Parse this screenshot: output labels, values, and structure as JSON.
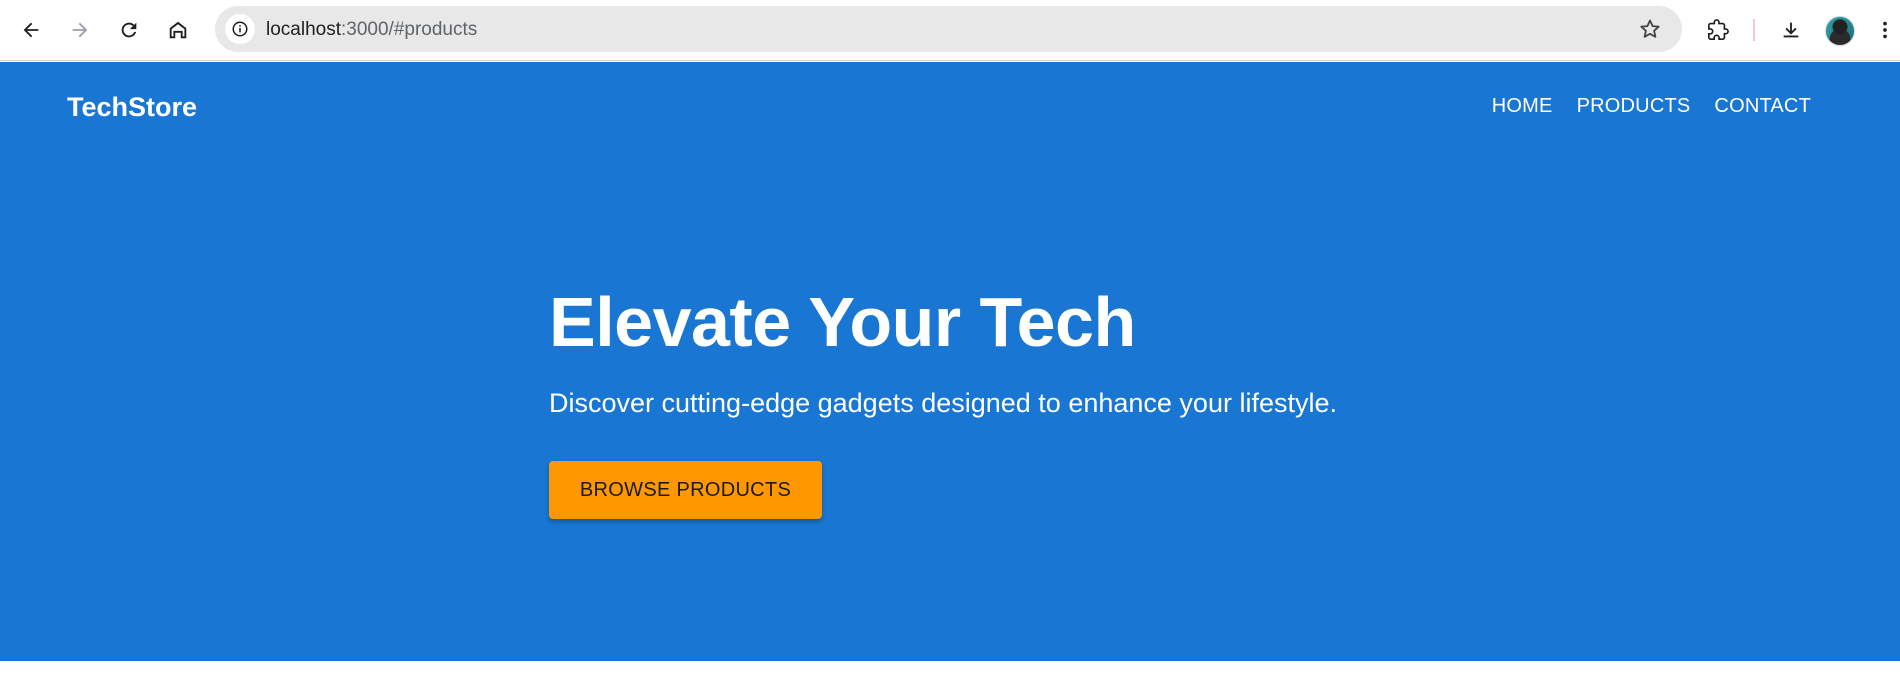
{
  "browser": {
    "url_host": "localhost",
    "url_rest": ":3000/#products",
    "icons": {
      "back": "arrow-left-icon",
      "forward": "arrow-right-icon",
      "reload": "reload-icon",
      "home": "home-icon",
      "site_info": "info-icon",
      "bookmark": "star-icon",
      "extensions": "puzzle-icon",
      "downloads": "download-icon",
      "profile": "avatar",
      "menu": "kebab-menu-icon"
    }
  },
  "site": {
    "logo": "TechStore",
    "nav": {
      "home": "HOME",
      "products": "PRODUCTS",
      "contact": "CONTACT"
    },
    "hero": {
      "title": "Elevate Your Tech",
      "subtitle": "Discover cutting-edge gadgets designed to enhance your lifestyle.",
      "cta": "BROWSE PRODUCTS"
    }
  },
  "colors": {
    "primary": "#1976d2",
    "accent": "#ff9800",
    "text_on_primary": "#ffffff"
  }
}
